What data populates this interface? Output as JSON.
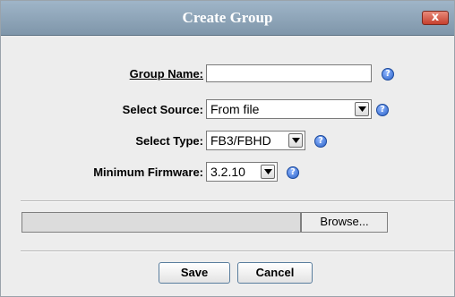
{
  "dialog": {
    "title": "Create Group",
    "close_glyph": "x"
  },
  "form": {
    "group_name_label": "Group Name:",
    "group_name_value": "",
    "select_source_label": "Select Source:",
    "select_source_value": "From file",
    "select_type_label": "Select Type:",
    "select_type_value": "FB3/FBHD",
    "minimum_firmware_label": "Minimum Firmware:",
    "minimum_firmware_value": "3.2.10",
    "help_glyph": "?"
  },
  "file": {
    "path_value": "",
    "browse_label": "Browse..."
  },
  "buttons": {
    "save_label": "Save",
    "cancel_label": "Cancel"
  },
  "icons": [
    "close-icon",
    "help-icon",
    "chevron-down-icon"
  ],
  "colors": {
    "titlebar": "#8fa6ba",
    "close_button": "#c6402e",
    "help_icon": "#2b62c8",
    "dialog_background": "#ededed"
  }
}
